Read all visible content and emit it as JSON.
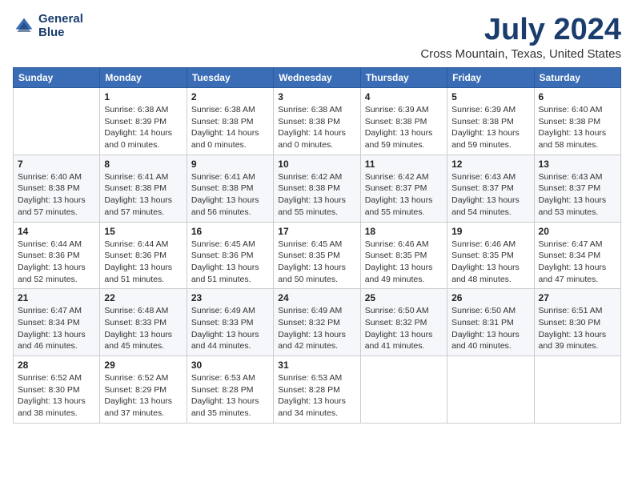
{
  "logo": {
    "line1": "General",
    "line2": "Blue"
  },
  "title": "July 2024",
  "location": "Cross Mountain, Texas, United States",
  "weekdays": [
    "Sunday",
    "Monday",
    "Tuesday",
    "Wednesday",
    "Thursday",
    "Friday",
    "Saturday"
  ],
  "weeks": [
    [
      {
        "day": "",
        "info": ""
      },
      {
        "day": "1",
        "info": "Sunrise: 6:38 AM\nSunset: 8:39 PM\nDaylight: 14 hours\nand 0 minutes."
      },
      {
        "day": "2",
        "info": "Sunrise: 6:38 AM\nSunset: 8:38 PM\nDaylight: 14 hours\nand 0 minutes."
      },
      {
        "day": "3",
        "info": "Sunrise: 6:38 AM\nSunset: 8:38 PM\nDaylight: 14 hours\nand 0 minutes."
      },
      {
        "day": "4",
        "info": "Sunrise: 6:39 AM\nSunset: 8:38 PM\nDaylight: 13 hours\nand 59 minutes."
      },
      {
        "day": "5",
        "info": "Sunrise: 6:39 AM\nSunset: 8:38 PM\nDaylight: 13 hours\nand 59 minutes."
      },
      {
        "day": "6",
        "info": "Sunrise: 6:40 AM\nSunset: 8:38 PM\nDaylight: 13 hours\nand 58 minutes."
      }
    ],
    [
      {
        "day": "7",
        "info": "Sunrise: 6:40 AM\nSunset: 8:38 PM\nDaylight: 13 hours\nand 57 minutes."
      },
      {
        "day": "8",
        "info": "Sunrise: 6:41 AM\nSunset: 8:38 PM\nDaylight: 13 hours\nand 57 minutes."
      },
      {
        "day": "9",
        "info": "Sunrise: 6:41 AM\nSunset: 8:38 PM\nDaylight: 13 hours\nand 56 minutes."
      },
      {
        "day": "10",
        "info": "Sunrise: 6:42 AM\nSunset: 8:38 PM\nDaylight: 13 hours\nand 55 minutes."
      },
      {
        "day": "11",
        "info": "Sunrise: 6:42 AM\nSunset: 8:37 PM\nDaylight: 13 hours\nand 55 minutes."
      },
      {
        "day": "12",
        "info": "Sunrise: 6:43 AM\nSunset: 8:37 PM\nDaylight: 13 hours\nand 54 minutes."
      },
      {
        "day": "13",
        "info": "Sunrise: 6:43 AM\nSunset: 8:37 PM\nDaylight: 13 hours\nand 53 minutes."
      }
    ],
    [
      {
        "day": "14",
        "info": "Sunrise: 6:44 AM\nSunset: 8:36 PM\nDaylight: 13 hours\nand 52 minutes."
      },
      {
        "day": "15",
        "info": "Sunrise: 6:44 AM\nSunset: 8:36 PM\nDaylight: 13 hours\nand 51 minutes."
      },
      {
        "day": "16",
        "info": "Sunrise: 6:45 AM\nSunset: 8:36 PM\nDaylight: 13 hours\nand 51 minutes."
      },
      {
        "day": "17",
        "info": "Sunrise: 6:45 AM\nSunset: 8:35 PM\nDaylight: 13 hours\nand 50 minutes."
      },
      {
        "day": "18",
        "info": "Sunrise: 6:46 AM\nSunset: 8:35 PM\nDaylight: 13 hours\nand 49 minutes."
      },
      {
        "day": "19",
        "info": "Sunrise: 6:46 AM\nSunset: 8:35 PM\nDaylight: 13 hours\nand 48 minutes."
      },
      {
        "day": "20",
        "info": "Sunrise: 6:47 AM\nSunset: 8:34 PM\nDaylight: 13 hours\nand 47 minutes."
      }
    ],
    [
      {
        "day": "21",
        "info": "Sunrise: 6:47 AM\nSunset: 8:34 PM\nDaylight: 13 hours\nand 46 minutes."
      },
      {
        "day": "22",
        "info": "Sunrise: 6:48 AM\nSunset: 8:33 PM\nDaylight: 13 hours\nand 45 minutes."
      },
      {
        "day": "23",
        "info": "Sunrise: 6:49 AM\nSunset: 8:33 PM\nDaylight: 13 hours\nand 44 minutes."
      },
      {
        "day": "24",
        "info": "Sunrise: 6:49 AM\nSunset: 8:32 PM\nDaylight: 13 hours\nand 42 minutes."
      },
      {
        "day": "25",
        "info": "Sunrise: 6:50 AM\nSunset: 8:32 PM\nDaylight: 13 hours\nand 41 minutes."
      },
      {
        "day": "26",
        "info": "Sunrise: 6:50 AM\nSunset: 8:31 PM\nDaylight: 13 hours\nand 40 minutes."
      },
      {
        "day": "27",
        "info": "Sunrise: 6:51 AM\nSunset: 8:30 PM\nDaylight: 13 hours\nand 39 minutes."
      }
    ],
    [
      {
        "day": "28",
        "info": "Sunrise: 6:52 AM\nSunset: 8:30 PM\nDaylight: 13 hours\nand 38 minutes."
      },
      {
        "day": "29",
        "info": "Sunrise: 6:52 AM\nSunset: 8:29 PM\nDaylight: 13 hours\nand 37 minutes."
      },
      {
        "day": "30",
        "info": "Sunrise: 6:53 AM\nSunset: 8:28 PM\nDaylight: 13 hours\nand 35 minutes."
      },
      {
        "day": "31",
        "info": "Sunrise: 6:53 AM\nSunset: 8:28 PM\nDaylight: 13 hours\nand 34 minutes."
      },
      {
        "day": "",
        "info": ""
      },
      {
        "day": "",
        "info": ""
      },
      {
        "day": "",
        "info": ""
      }
    ]
  ]
}
